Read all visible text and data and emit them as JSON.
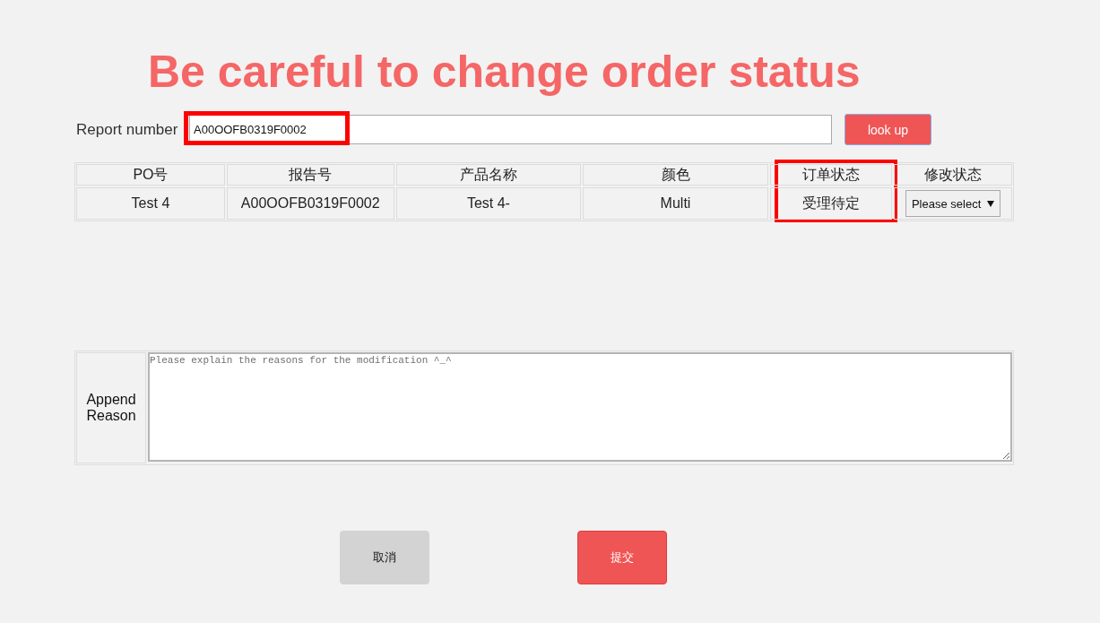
{
  "title": "Be careful to change order status",
  "search": {
    "label": "Report number",
    "value": "A00OOFB0319F0002",
    "highlighted": true,
    "button": "look up"
  },
  "table": {
    "columns": [
      {
        "label": "PO号",
        "highlighted": false
      },
      {
        "label": "报告号",
        "highlighted": false
      },
      {
        "label": "产品名称",
        "highlighted": false
      },
      {
        "label": "颜色",
        "highlighted": false
      },
      {
        "label": "订单状态",
        "highlighted": true
      },
      {
        "label": "修改状态",
        "highlighted": false
      }
    ],
    "rows": [
      {
        "cells": [
          {
            "kind": "text",
            "text": "Test 4"
          },
          {
            "kind": "text",
            "text": "A00OOFB0319F0002"
          },
          {
            "kind": "text",
            "text": "Test 4-"
          },
          {
            "kind": "text",
            "text": "Multi"
          },
          {
            "kind": "text",
            "text": "受理待定"
          },
          {
            "kind": "select",
            "text": "Please select"
          }
        ]
      }
    ]
  },
  "reason": {
    "label": "Append Reason",
    "placeholder": "Please explain the reasons for the modification ^_^"
  },
  "buttons": [
    {
      "kind": "cancel",
      "label": "取消"
    },
    {
      "kind": "submit",
      "label": "提交"
    }
  ]
}
